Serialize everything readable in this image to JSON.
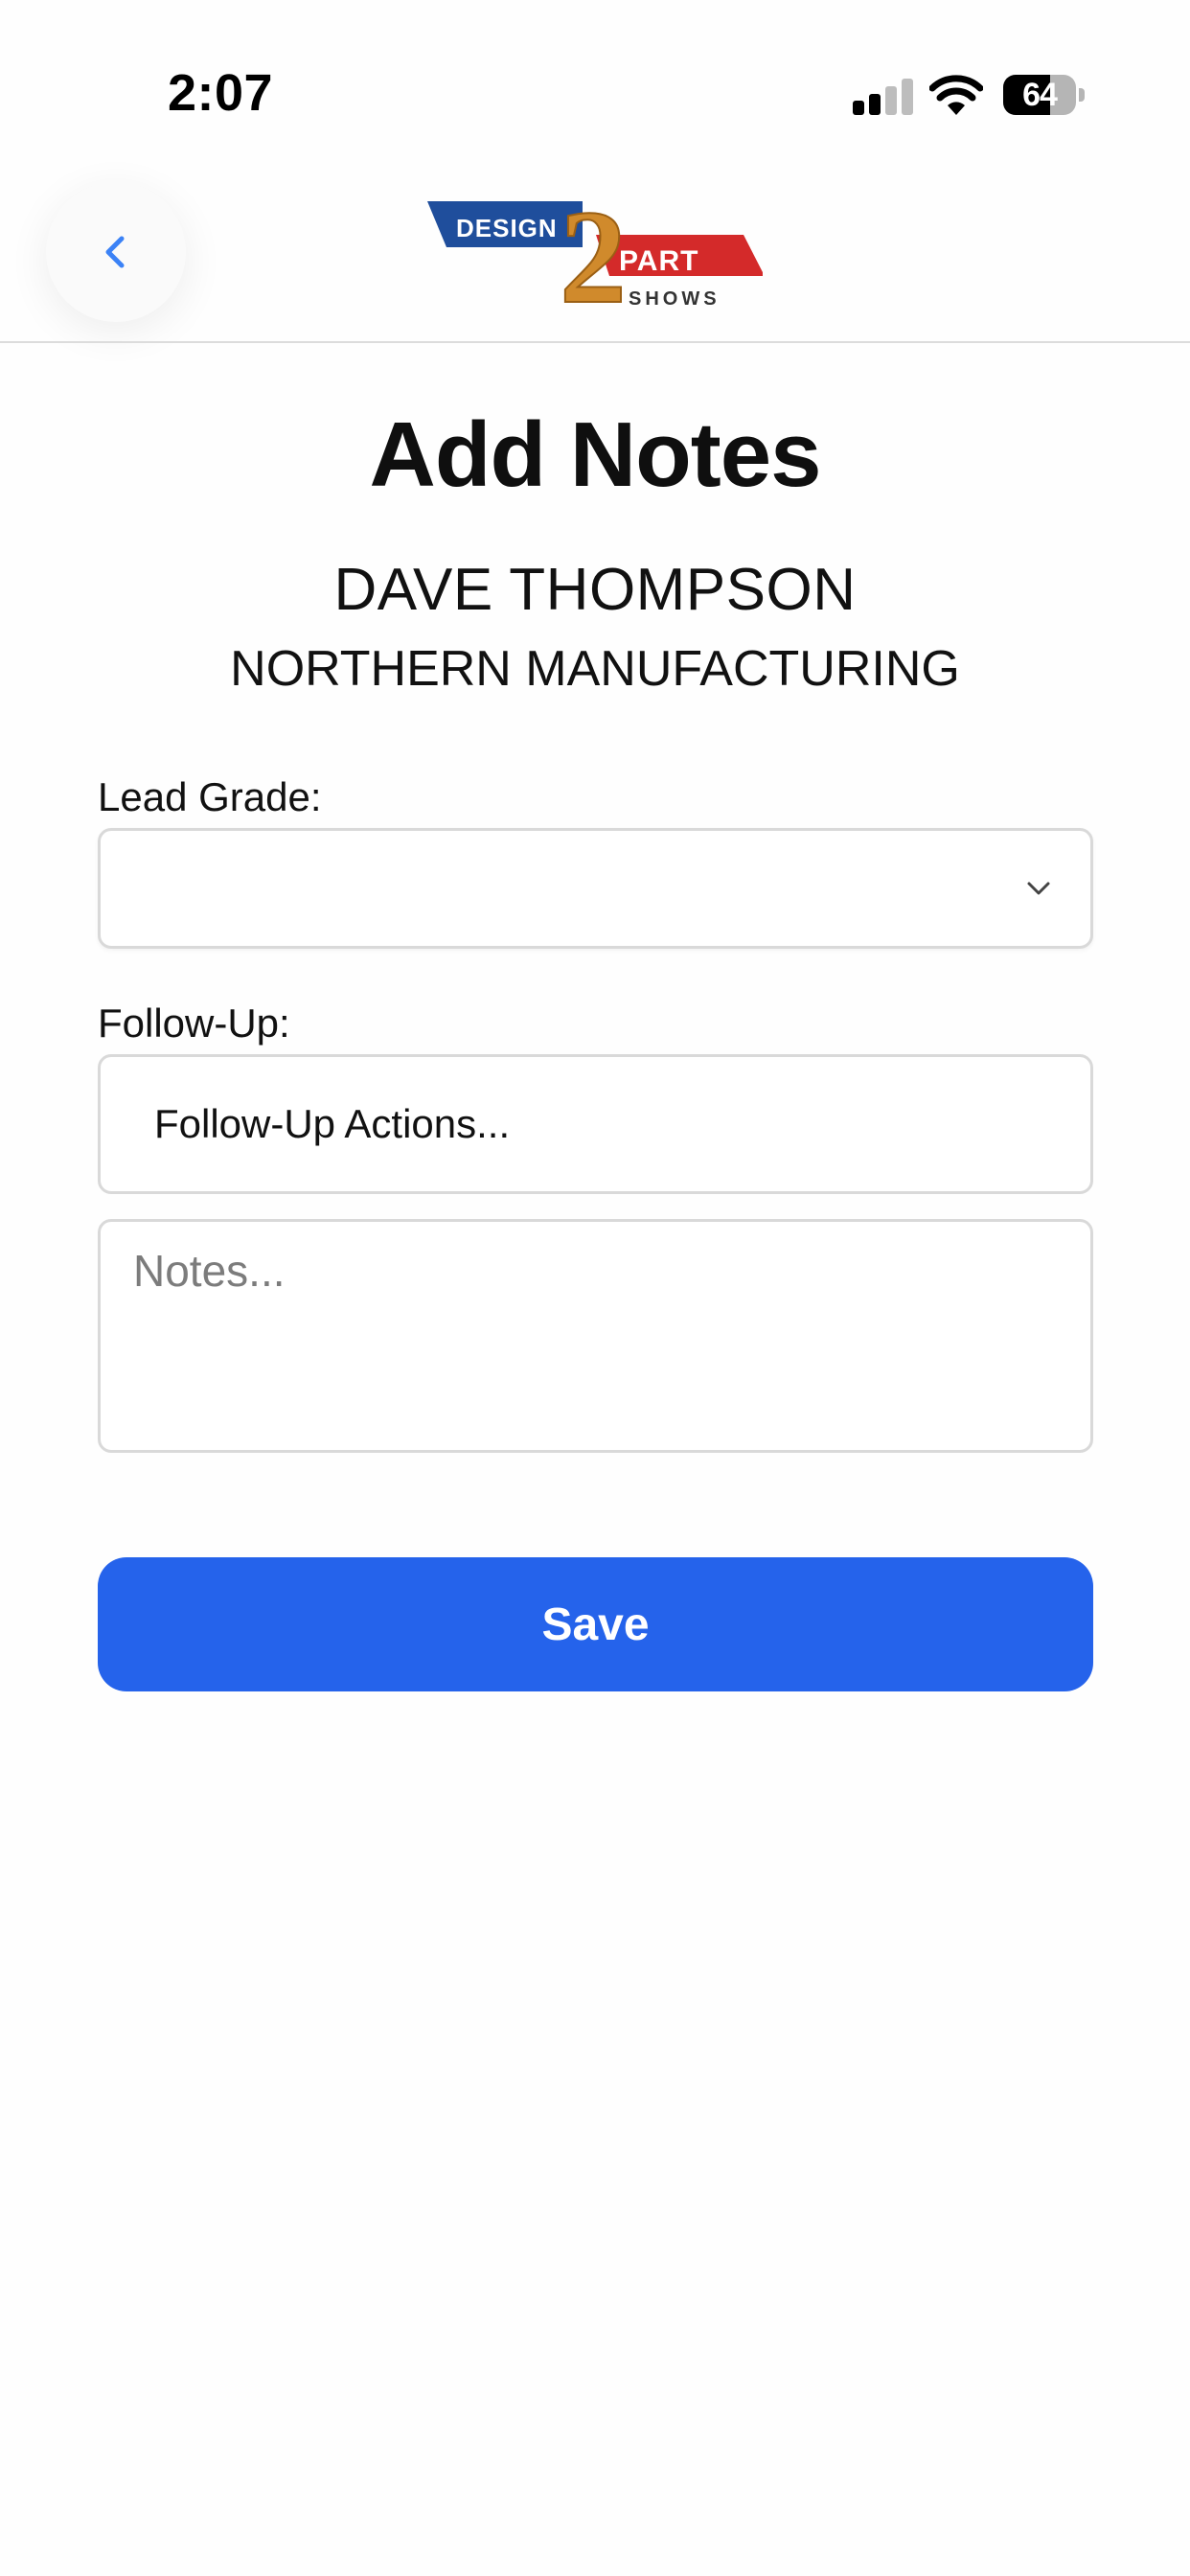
{
  "status_bar": {
    "time": "2:07",
    "battery_percent": "64",
    "battery_level": 0.64,
    "signal_bars": 2
  },
  "header": {
    "back_icon": "chevron-left-icon",
    "logo": {
      "word_design": "DESIGN",
      "word_part": "PART",
      "word_shows": "SHOWS",
      "numeral": "2"
    }
  },
  "page": {
    "title": "Add Notes",
    "contact_name": "DAVE THOMPSON",
    "company": "NORTHERN MANUFACTURING"
  },
  "form": {
    "lead_grade_label": "Lead Grade:",
    "lead_grade_value": "",
    "follow_up_label": "Follow-Up:",
    "follow_up_value": "Follow-Up Actions...",
    "notes_placeholder": "Notes...",
    "notes_value": "",
    "save_label": "Save"
  },
  "colors": {
    "accent": "#2563eb",
    "back_icon": "#3b82f6",
    "logo_blue": "#1f4e9c",
    "logo_red": "#d42a2a",
    "logo_gold": "#d08a2c"
  }
}
